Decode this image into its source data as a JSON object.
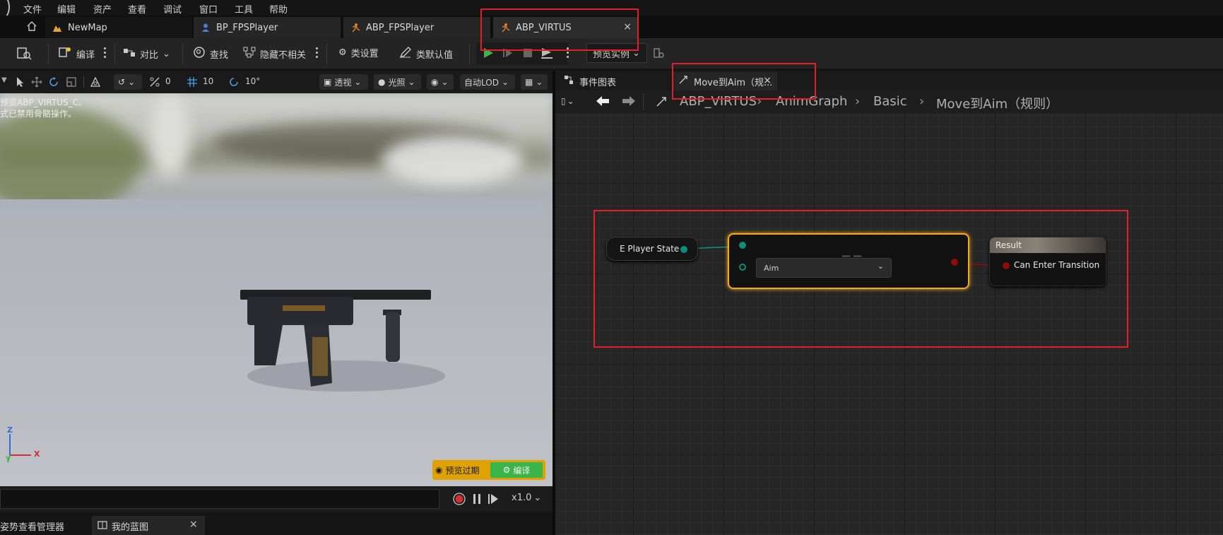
{
  "menu": [
    "文件",
    "编辑",
    "资产",
    "查看",
    "调试",
    "窗口",
    "工具",
    "帮助"
  ],
  "tabs": [
    {
      "label": "NewMap"
    },
    {
      "label": "BP_FPSPlayer"
    },
    {
      "label": "ABP_FPSPlayer"
    },
    {
      "label": "ABP_VIRTUS",
      "close": "×"
    }
  ],
  "toolbar": {
    "compile": "编译",
    "diff": "对比",
    "find": "查找",
    "hide_unrelated": "隐藏不相关",
    "class_settings": "类设置",
    "class_defaults": "类默认值",
    "preview_instance": "预览实例"
  },
  "viewport_toolbar": {
    "angle_value": "0",
    "grid_value": "10",
    "rot_value": "10°",
    "perspective": "透视",
    "lighting": "光照",
    "lod": "自动LOD"
  },
  "viewport": {
    "line1": "预览ABP_VIRTUS_C。",
    "line2": "式已禁用骨骼操作。",
    "axis_z": "Z",
    "axis_x": "X",
    "axis_y": "Y",
    "preview_expired": "预览过期",
    "compile": "编译",
    "speed": "x1.0"
  },
  "graph_tabs": {
    "event_graph": "事件图表",
    "rule_tab": "Move到Aim（规...",
    "close": "×"
  },
  "breadcrumb": [
    "ABP_VIRTUS",
    "AnimGraph",
    "Basic",
    "Move到Aim（规则）"
  ],
  "nodes": {
    "player_state": "E Player State",
    "enum_value": "Aim",
    "equals_symbol": "==",
    "result_title": "Result",
    "result_pin": "Can Enter Transition"
  },
  "bottom_tabs": {
    "pose_manager": "姿势查看管理器",
    "my_blueprint": "我的蓝图",
    "close": "×"
  },
  "colors": {
    "accent_play": "#3bb54a",
    "highlight_box": "#e0202a",
    "selected_node": "#f5a623",
    "enum_pin": "#0d8d7d",
    "bool_pin": "#8e0b0b"
  }
}
